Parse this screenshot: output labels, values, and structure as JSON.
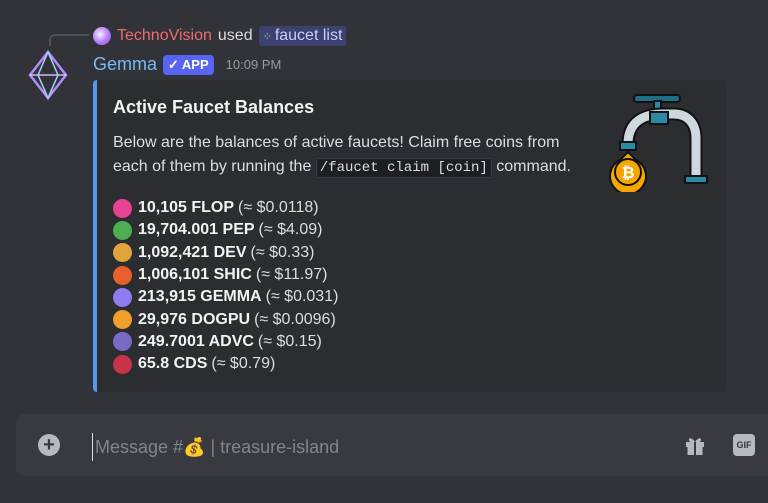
{
  "reply": {
    "username": "TechnoVision",
    "used_text": "used",
    "command": "faucet list"
  },
  "message": {
    "author": "Gemma",
    "badge": "APP",
    "timestamp": "10:09 PM"
  },
  "embed": {
    "title": "Active Faucet Balances",
    "description_before": "Below are the balances of active faucets! Claim free coins from each of them by running the ",
    "command_code": "/faucet claim [coin]",
    "description_after": " command.",
    "accent_color": "#5897ee",
    "balances": [
      {
        "icon": "flop-coin-icon",
        "amount": "10,105 FLOP",
        "value": "(≈ $0.0118)",
        "color": "#e84393"
      },
      {
        "icon": "pep-coin-icon",
        "amount": "19,704.001 PEP",
        "value": "(≈ $4.09)",
        "color": "#4caf50"
      },
      {
        "icon": "dev-coin-icon",
        "amount": "1,092,421 DEV",
        "value": "(≈ $0.33)",
        "color": "#e0a43a"
      },
      {
        "icon": "shic-coin-icon",
        "amount": "1,006,101 SHIC",
        "value": "(≈ $11.97)",
        "color": "#e8602c"
      },
      {
        "icon": "gemma-coin-icon",
        "amount": "213,915 GEMMA",
        "value": "(≈ $0.031)",
        "color": "#8e7cf0"
      },
      {
        "icon": "dogpu-coin-icon",
        "amount": "29,976 DOGPU",
        "value": "(≈ $0.0096)",
        "color": "#f0a02a"
      },
      {
        "icon": "advc-coin-icon",
        "amount": "249.7001 ADVC",
        "value": "(≈ $0.15)",
        "color": "#7a6ac8"
      },
      {
        "icon": "cds-coin-icon",
        "amount": "65.8 CDS",
        "value": "(≈ $0.79)",
        "color": "#c8334a"
      }
    ]
  },
  "composer": {
    "placeholder": "Message #💰 | treasure-island",
    "gif_label": "GIF"
  },
  "colors": {
    "background": "#313338",
    "embed_background": "#2b2d31",
    "author": "#7ab8f5",
    "reply_user": "#f06b6b",
    "app_badge": "#5865f2"
  }
}
